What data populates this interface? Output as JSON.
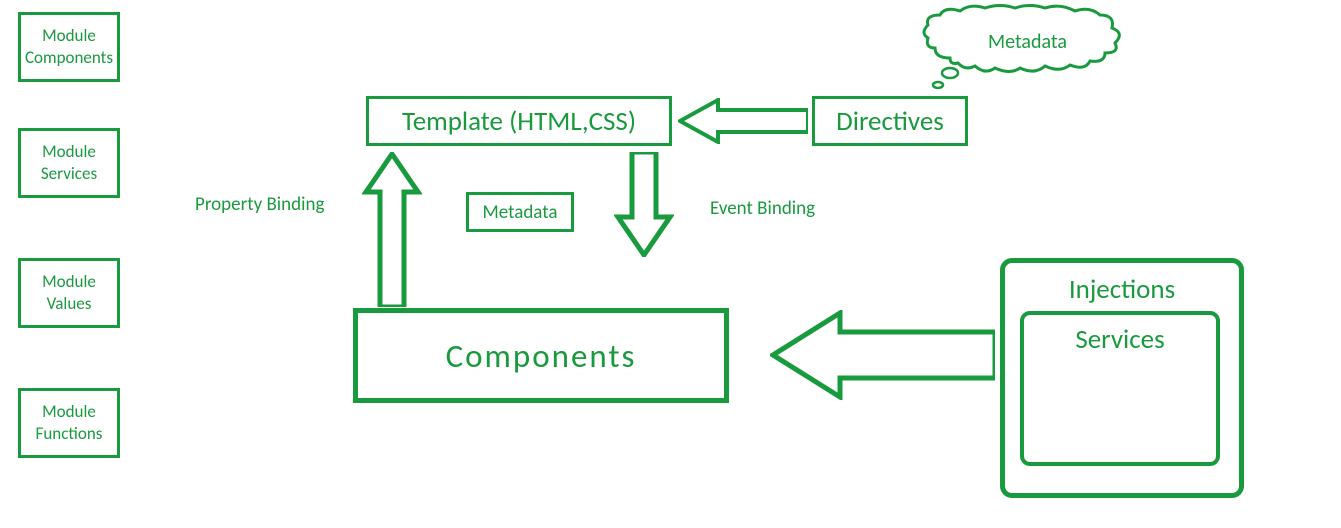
{
  "sidebar": {
    "items": [
      {
        "line1": "Module",
        "line2": "Components"
      },
      {
        "line1": "Module",
        "line2": "Services"
      },
      {
        "line1": "Module",
        "line2": "Values"
      },
      {
        "line1": "Module",
        "line2": "Functions"
      }
    ]
  },
  "template_box": "Template (HTML,CSS)",
  "directives_box": "Directives",
  "metadata_cloud": "Metadata",
  "metadata_box": "Metadata",
  "components_box": "Components",
  "injections_label": "Injections",
  "services_label": "Services",
  "property_binding_label": "Property Binding",
  "event_binding_label": "Event Binding"
}
